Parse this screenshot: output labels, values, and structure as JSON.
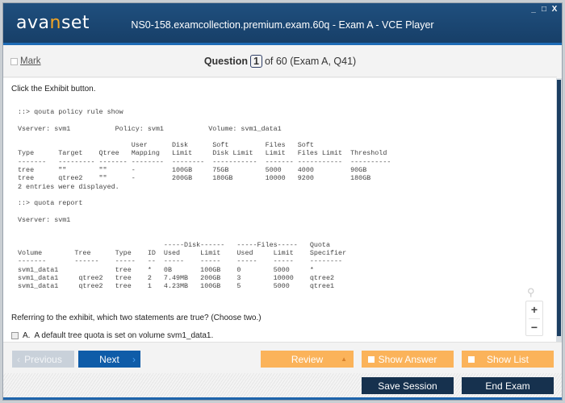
{
  "window": {
    "logo_prefix": "ava",
    "logo_accent": "n",
    "logo_suffix": "set",
    "title": "NS0-158.examcollection.premium.exam.60q - Exam A - VCE Player",
    "controls": {
      "minimize": "_",
      "maximize": "□",
      "close": "X"
    }
  },
  "header": {
    "mark_label": "Mark",
    "question_label": "Question",
    "question_number": "1",
    "question_suffix": "of 60 (Exam A, Q41)"
  },
  "content": {
    "instruction": "Click the Exhibit button.",
    "exhibit": {
      "policy_command": "::> qouta policy rule show",
      "policy_context": "Vserver: svm1           Policy: svm1           Volume: svm1_data1",
      "policy_headers": [
        [
          "",
          "",
          "",
          "User",
          "Disk",
          "Soft",
          "Files",
          "Soft",
          ""
        ],
        [
          "Type",
          "Target",
          "Qtree",
          "Mapping",
          "Limit",
          "Disk Limit",
          "Limit",
          "Files Limit",
          "Threshold"
        ]
      ],
      "policy_rows": [
        [
          "tree",
          "\"\"",
          "\"\"",
          "-",
          "100GB",
          "75GB",
          "5000",
          "4000",
          "90GB"
        ],
        [
          "tree",
          "qtree2",
          "\"\"",
          "-",
          "200GB",
          "180GB",
          "10000",
          "9200",
          "180GB"
        ]
      ],
      "policy_footer": "2 entries were displayed.",
      "report_command": "::> quota report",
      "report_context": "Vserver: svm1",
      "report_group_headers": {
        "disk": "-----Disk------",
        "files": "-----Files-----",
        "quota": "Quota"
      },
      "report_headers": [
        "Volume",
        "Tree",
        "Type",
        "ID",
        "Used",
        "Limit",
        "Used",
        "Limit",
        "Specifier"
      ],
      "report_rows": [
        [
          "svm1_data1",
          "",
          "tree",
          "*",
          "0B",
          "100GB",
          "0",
          "5000",
          "*"
        ],
        [
          "svm1_data1",
          "qtree2",
          "tree",
          "2",
          "7.49MB",
          "200GB",
          "3",
          "10000",
          "qtree2"
        ],
        [
          "svm1_data1",
          "qtree2",
          "tree",
          "1",
          "4.23MB",
          "100GB",
          "5",
          "5000",
          "qtree1"
        ]
      ]
    },
    "question": "Referring to the exhibit, which two statements are true? (Choose two.)",
    "options": [
      {
        "letter": "A.",
        "text": "A default tree quota is set on volume svm1_data1.",
        "checked": false
      }
    ],
    "zoom": {
      "in": "+",
      "out": "−",
      "search_icon": "⚲"
    }
  },
  "nav": {
    "previous": "Previous",
    "next": "Next",
    "review": "Review",
    "show_answer": "Show Answer",
    "show_list": "Show List",
    "save_session": "Save Session",
    "end_exam": "End Exam"
  }
}
